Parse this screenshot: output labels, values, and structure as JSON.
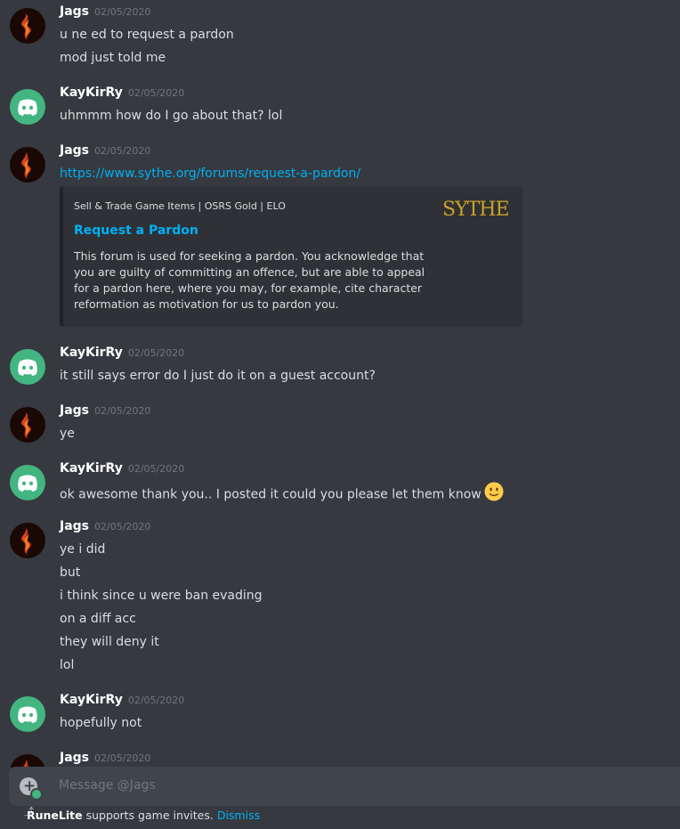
{
  "messages": [
    {
      "author": "Jags",
      "avatar": "jags",
      "timestamp": "02/05/2020",
      "lines": [
        "u ne ed to request a pardon",
        "mod just told me"
      ]
    },
    {
      "author": "KayKirRy",
      "avatar": "discord",
      "timestamp": "02/05/2020",
      "lines": [
        "uhmmm how do I go about that? lol"
      ]
    },
    {
      "author": "Jags",
      "avatar": "jags",
      "timestamp": "02/05/2020",
      "link": "https://www.sythe.org/forums/request-a-pardon/",
      "embed": {
        "provider": "Sell & Trade Game Items | OSRS Gold | ELO",
        "title": "Request a Pardon",
        "description": "This forum is used for seeking a pardon. You acknowledge that you are guilty of committing an offence, but are able to appeal for a pardon here, where you may, for example, cite character reformation as motivation for us to pardon you.",
        "thumbnail_text": "SYTHE"
      }
    },
    {
      "author": "KayKirRy",
      "avatar": "discord",
      "timestamp": "02/05/2020",
      "lines": [
        "it still says error do I just do it on a guest account?"
      ]
    },
    {
      "author": "Jags",
      "avatar": "jags",
      "timestamp": "02/05/2020",
      "lines": [
        "ye"
      ]
    },
    {
      "author": "KayKirRy",
      "avatar": "discord",
      "timestamp": "02/05/2020",
      "lines": [
        "ok awesome thank you.. I posted it could you please let them know"
      ],
      "emoji": "slightly-smiling-face"
    },
    {
      "author": "Jags",
      "avatar": "jags",
      "timestamp": "02/05/2020",
      "lines": [
        "ye i did",
        "but",
        "i think since u were ban evading",
        "on a diff acc",
        "they will deny it",
        "lol"
      ]
    },
    {
      "author": "KayKirRy",
      "avatar": "discord",
      "timestamp": "02/05/2020",
      "lines": [
        "hopefully not"
      ]
    },
    {
      "author": "Jags",
      "avatar": "jags",
      "timestamp": "02/05/2020",
      "lines": []
    }
  ],
  "composer": {
    "placeholder": "Message @Jags"
  },
  "notice": {
    "brand": "RuneLite",
    "text": " supports game invites. ",
    "dismiss": "Dismiss"
  },
  "colors": {
    "background": "#36393f",
    "link": "#00b0f4",
    "discord_avatar": "#43b581"
  }
}
